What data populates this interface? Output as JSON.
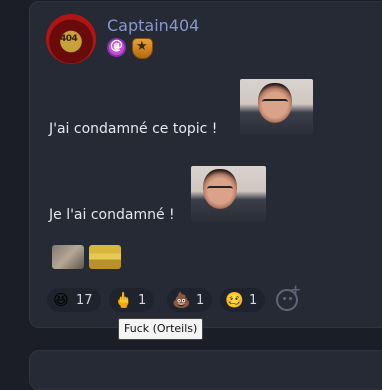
{
  "post": {
    "username": "Captain404",
    "avatar_text": "404",
    "badges": [
      "spiral-badge-icon",
      "shield-star-badge-icon"
    ],
    "messages": [
      {
        "text": "J'ai condamné ce topic !"
      },
      {
        "text": "Je l'ai condamné !"
      }
    ]
  },
  "reactions": [
    {
      "icon": "laughing-face-icon",
      "glyph": "😆",
      "count": "17"
    },
    {
      "icon": "middle-finger-icon",
      "glyph": "🖕",
      "count": "1"
    },
    {
      "icon": "poop-icon",
      "glyph": "💩",
      "count": "1"
    },
    {
      "icon": "smiley-face-icon",
      "glyph": "🥴",
      "count": "1"
    }
  ],
  "add_reaction_icon": "add-reaction-icon",
  "tooltip": "Fuck (Orteils)",
  "colors": {
    "background": "#1b1e27",
    "card": "#252a35",
    "username": "#8a97c9",
    "text": "#e6e8ee"
  }
}
